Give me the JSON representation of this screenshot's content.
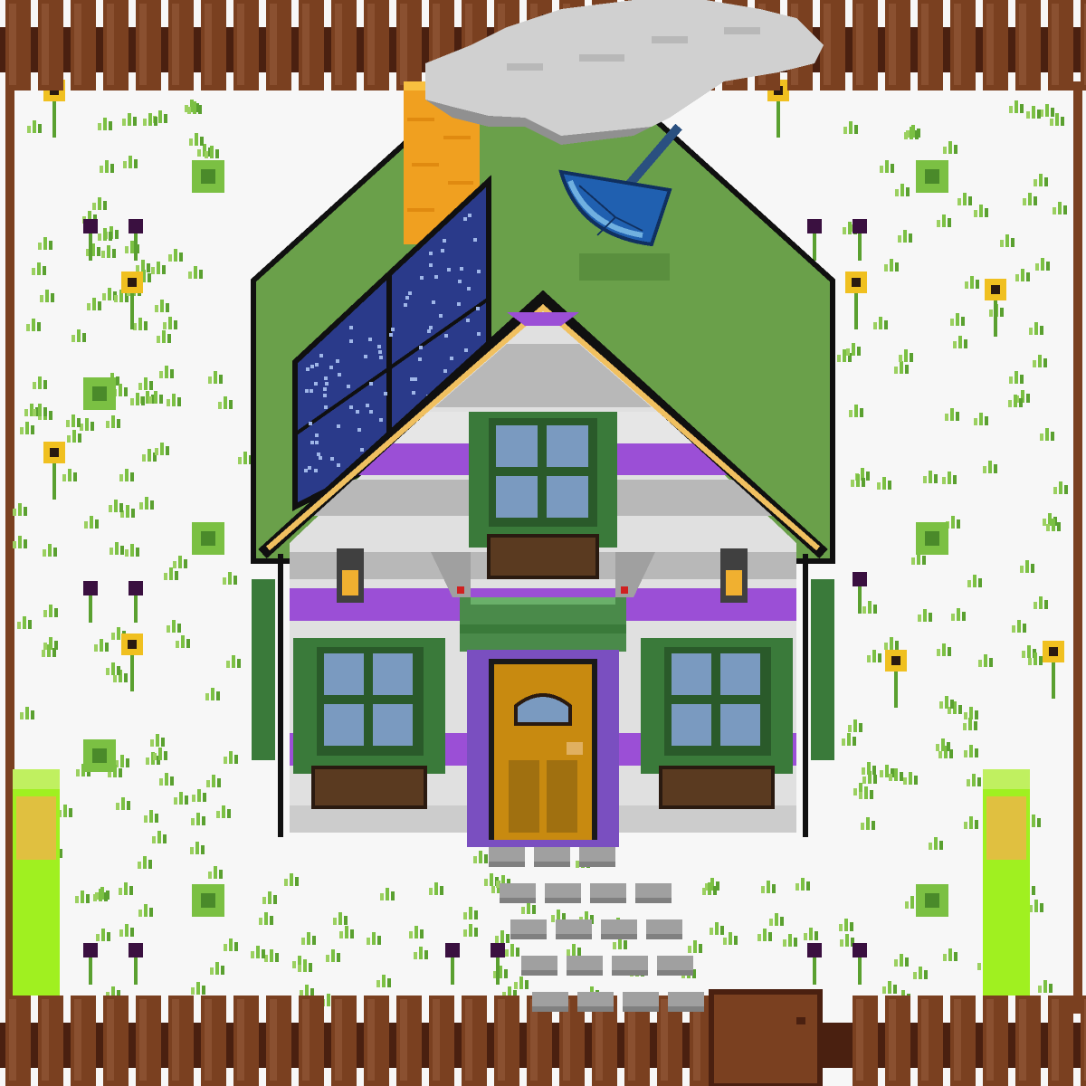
{
  "scene": {
    "type": "pixel-art farm house",
    "elements": [
      "fence",
      "grass",
      "flowers",
      "house",
      "solar-panels",
      "satellite-dish",
      "chimney",
      "smoke-cloud",
      "lamps",
      "windows",
      "flower-boxes",
      "door",
      "stone-path",
      "gate",
      "lamp-posts"
    ]
  },
  "colors": {
    "ground": "#f7f7f7",
    "fence": "#7a4020",
    "fence_dark": "#4a2010",
    "roof": "#6aa04a",
    "roof_outline": "#101010",
    "trim": "#f0c060",
    "wall": "#e0e0e0",
    "wall_stripe_gray": "#b0b0b0",
    "wall_stripe_purple": "#9b4fd6",
    "shutter": "#3a7a3a",
    "window_glass": "#7a9ac0",
    "door": "#c88a10",
    "door_frame": "#7a4fc0",
    "solar": "#2a3a8a",
    "dish": "#2060b0",
    "chimney": "#f0a020",
    "smoke": "#cccccc",
    "lamp_post": "#a0f020",
    "stone": "#a0a0a0"
  }
}
